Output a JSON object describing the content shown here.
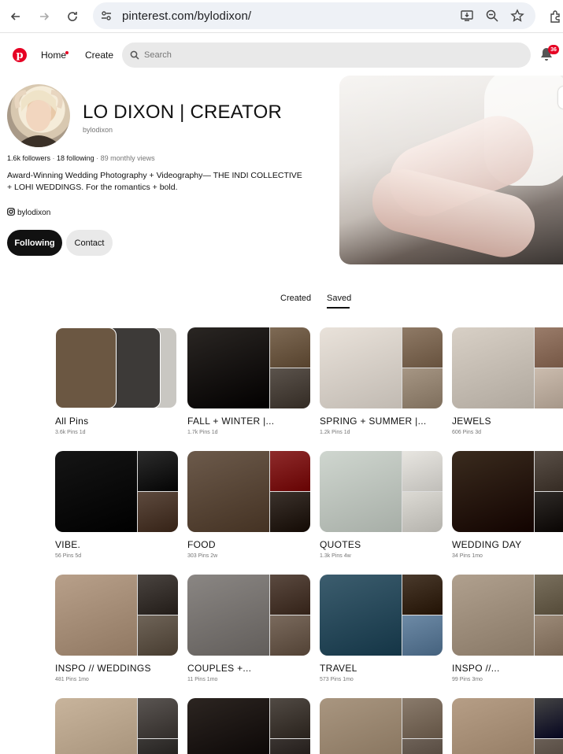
{
  "browser": {
    "url": "pinterest.com/bylodixon/"
  },
  "header": {
    "home": "Home",
    "create": "Create",
    "search_placeholder": "Search",
    "notifications_count": "36"
  },
  "profile": {
    "name": "LO DIXON | CREATOR",
    "handle": "bylodixon",
    "followers": "1.6k followers",
    "following": "18 following",
    "monthly_views": "89 monthly views",
    "bio_line1": "Award-Winning Wedding Photography + Videography— THE INDI COLLECTIVE",
    "bio_line2": "+ LOHI WEDDINGS. For the romantics + bold.",
    "instagram": "bylodixon",
    "following_button": "Following",
    "contact_button": "Contact"
  },
  "tabs": {
    "created": "Created",
    "saved": "Saved",
    "active": "Saved"
  },
  "boards": [
    {
      "title": "All Pins",
      "pins": "3.6k Pins",
      "age": "1d",
      "colors": [
        "#6b5742",
        "#3d3a38",
        "#c9c7c2"
      ]
    },
    {
      "title": "FALL + WINTER |...",
      "pins": "1.7k Pins",
      "age": "1d",
      "colors": [
        "#2a2623",
        "#7e6a55",
        "#5b534c"
      ]
    },
    {
      "title": "SPRING + SUMMER |...",
      "pins": "1.2k Pins",
      "age": "1d",
      "colors": [
        "#e9e2da",
        "#8f7a66",
        "#a69684"
      ]
    },
    {
      "title": "JEWELS",
      "pins": "606 Pins",
      "age": "3d",
      "colors": [
        "#d8d0c6",
        "#9a7c6a",
        "#cbbcae"
      ]
    },
    {
      "title": "VIBE.",
      "pins": "56 Pins",
      "age": "5d",
      "colors": [
        "#151515",
        "#2c2c2c",
        "#5d4a3e"
      ]
    },
    {
      "title": "FOOD",
      "pins": "303 Pins",
      "age": "2w",
      "colors": [
        "#6c5a4b",
        "#8e2b2b",
        "#3b322c"
      ]
    },
    {
      "title": "QUOTES",
      "pins": "1.3k Pins",
      "age": "4w",
      "colors": [
        "#cfd6cf",
        "#e8e6e1",
        "#dcdad4"
      ]
    },
    {
      "title": "WEDDING DAY",
      "pins": "34 Pins",
      "age": "1mo",
      "colors": [
        "#3a2b1e",
        "#5a5048",
        "#2e2a27"
      ]
    },
    {
      "title": "INSPO // WEDDINGS",
      "pins": "481 Pins",
      "age": "1mo",
      "colors": [
        "#b8a08a",
        "#4a4440",
        "#6f6458"
      ]
    },
    {
      "title": "COUPLES +...",
      "pins": "11 Pins",
      "age": "1mo",
      "colors": [
        "#8a8683",
        "#5b4a40",
        "#7a6a5d"
      ]
    },
    {
      "title": "TRAVEL",
      "pins": "573 Pins",
      "age": "1mo",
      "colors": [
        "#3c5d6e",
        "#4a3a2c",
        "#6d8aa6"
      ]
    },
    {
      "title": "INSPO //...",
      "pins": "99 Pins",
      "age": "3mo",
      "colors": [
        "#b0a08e",
        "#7a705e",
        "#9c8a78"
      ]
    },
    {
      "title": "",
      "pins": "",
      "age": "",
      "colors": [
        "#c8b49c",
        "#5a5552",
        "#3b3836"
      ]
    },
    {
      "title": "",
      "pins": "",
      "age": "",
      "colors": [
        "#2c2521",
        "#514a44",
        "#3a3431"
      ]
    },
    {
      "title": "",
      "pins": "",
      "age": "",
      "colors": [
        "#a99680",
        "#8a7b6c",
        "#6e6258"
      ]
    },
    {
      "title": "",
      "pins": "",
      "age": "",
      "colors": [
        "#b69e86",
        "#444",
        "#6a5f56"
      ]
    }
  ]
}
